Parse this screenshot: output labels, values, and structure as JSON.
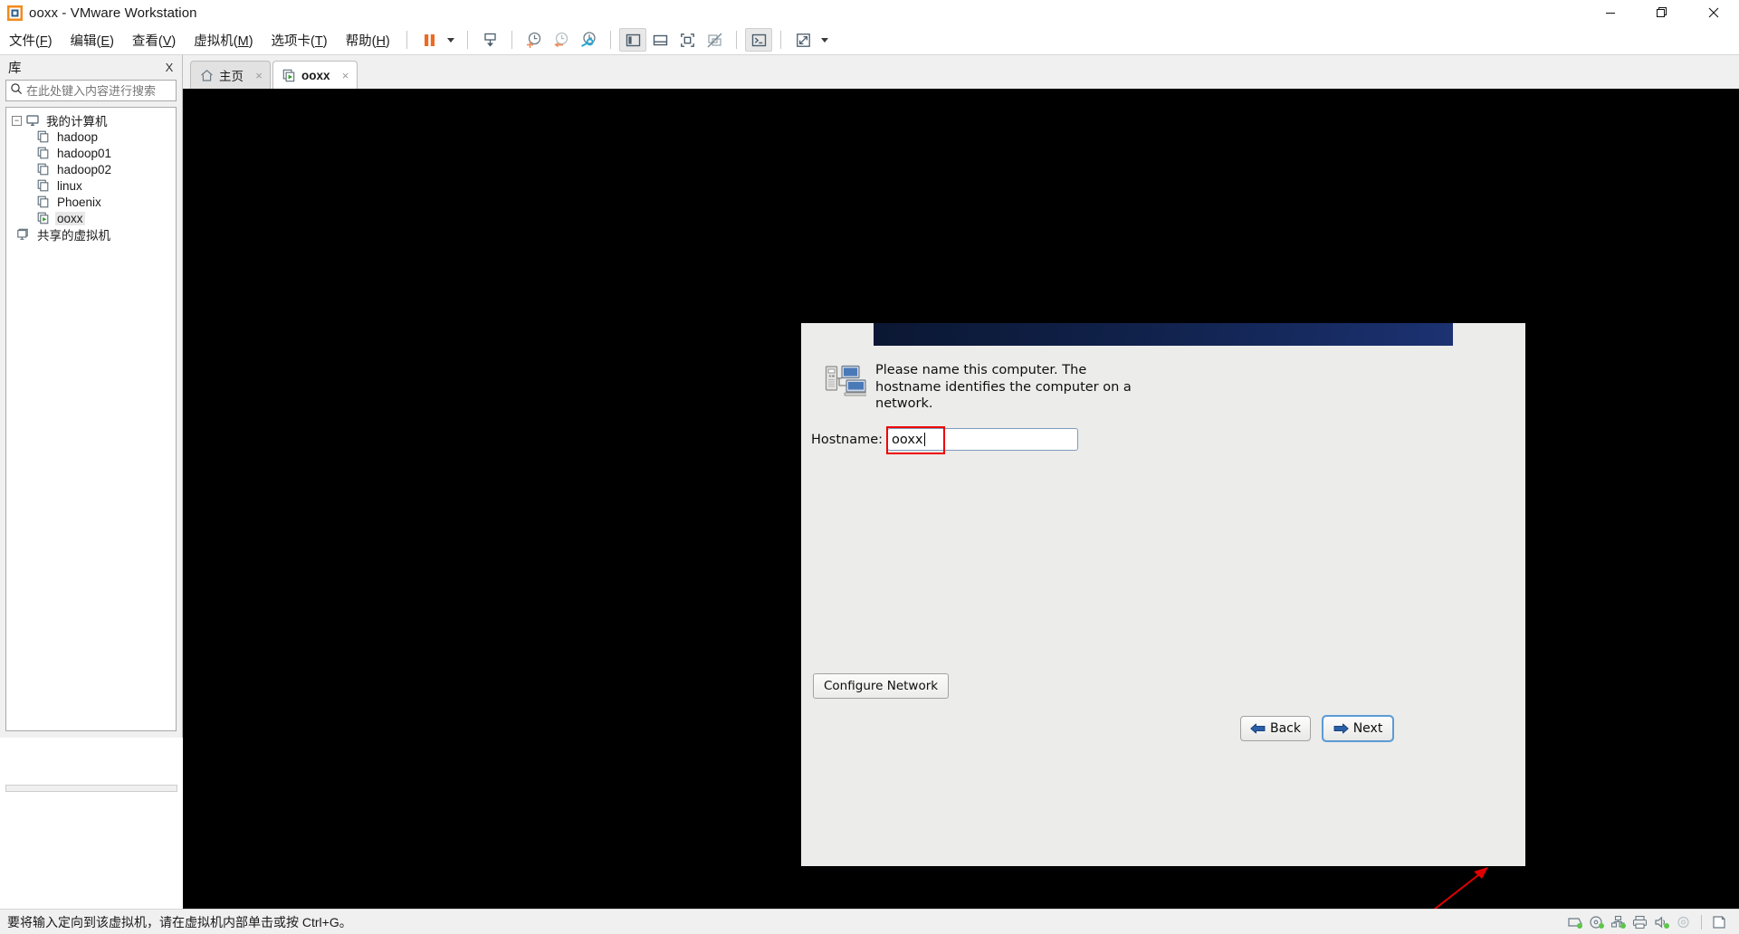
{
  "window": {
    "title": "ooxx - VMware Workstation",
    "app_icon": "vmware-logo-icon",
    "controls": {
      "minimize": "—",
      "restore": "❐",
      "close": "✕"
    }
  },
  "menubar": {
    "items": [
      {
        "name": "file",
        "text": "文件(F)",
        "label": "文件(",
        "accel": "F",
        "tail": ")"
      },
      {
        "name": "edit",
        "text": "编辑(E)",
        "label": "编辑(",
        "accel": "E",
        "tail": ")"
      },
      {
        "name": "view",
        "text": "查看(V)",
        "label": "查看(",
        "accel": "V",
        "tail": ")"
      },
      {
        "name": "vm",
        "text": "虚拟机(M)",
        "label": "虚拟机(",
        "accel": "M",
        "tail": ")"
      },
      {
        "name": "tabs",
        "text": "选项卡(T)",
        "label": "选项卡(",
        "accel": "T",
        "tail": ")"
      },
      {
        "name": "help",
        "text": "帮助(H)",
        "label": "帮助(",
        "accel": "H",
        "tail": ")"
      }
    ]
  },
  "toolbar": {
    "buttons": [
      {
        "name": "suspend-button",
        "icon": "pause-icon",
        "title": "挂起"
      },
      {
        "name": "power-dropdown",
        "icon": "chevron-down-icon",
        "title": "电源"
      },
      {
        "name": "send-ctrl-alt-del-button",
        "icon": "send-key-icon",
        "title": "发送组合键"
      },
      {
        "name": "take-snapshot-button",
        "icon": "snapshot-add-icon",
        "title": "拍摄快照"
      },
      {
        "name": "revert-snapshot-button",
        "icon": "snapshot-revert-icon",
        "title": "恢复快照"
      },
      {
        "name": "snapshot-manager-button",
        "icon": "snapshot-manager-icon",
        "title": "快照管理器"
      },
      {
        "name": "show-library-button",
        "icon": "panel-left-icon",
        "title": "显示库"
      },
      {
        "name": "show-thumbnail-bar-button",
        "icon": "panel-bottom-icon",
        "title": "显示缩略图栏"
      },
      {
        "name": "enter-fullscreen-button",
        "icon": "fullscreen-icon",
        "title": "全屏"
      },
      {
        "name": "unity-mode-button",
        "icon": "unity-icon",
        "title": "Unity 模式"
      },
      {
        "name": "console-button",
        "icon": "terminal-icon",
        "title": "控制台"
      },
      {
        "name": "stretch-guest-button",
        "icon": "resize-icon",
        "title": "自动调整大小"
      },
      {
        "name": "stretch-dropdown",
        "icon": "chevron-down-icon",
        "title": "更多"
      }
    ]
  },
  "sidebar": {
    "title": "库",
    "close_label": "X",
    "search": {
      "placeholder": "在此处键入内容进行搜索",
      "value": "",
      "icon": "search-icon",
      "dropdown_icon": "chevron-down-icon"
    },
    "tree": {
      "root": {
        "label": "我的计算机",
        "icon": "computer-icon",
        "expanded": true,
        "twisty": "−"
      },
      "children": [
        {
          "label": "hadoop",
          "icon": "vm-icon",
          "running": false,
          "selected": false
        },
        {
          "label": "hadoop01",
          "icon": "vm-icon",
          "running": false,
          "selected": false
        },
        {
          "label": "hadoop02",
          "icon": "vm-icon",
          "running": false,
          "selected": false
        },
        {
          "label": "linux",
          "icon": "vm-icon",
          "running": false,
          "selected": false
        },
        {
          "label": "Phoenix",
          "icon": "vm-icon",
          "running": false,
          "selected": false
        },
        {
          "label": "ooxx",
          "icon": "vm-running-icon",
          "running": true,
          "selected": true
        }
      ],
      "shared": {
        "label": "共享的虚拟机",
        "icon": "shared-vm-icon"
      }
    }
  },
  "tabs": [
    {
      "name": "tab-home",
      "label": "主页",
      "icon": "home-icon",
      "active": false,
      "close_icon": "×"
    },
    {
      "name": "tab-ooxx",
      "label": "ooxx",
      "icon": "vm-running-icon",
      "active": true,
      "close_icon": "×"
    }
  ],
  "installer": {
    "icon": "computer-network-icon",
    "description": "Please name this computer.  The hostname identifies the computer on a network.",
    "hostname_label": "Hostname:",
    "hostname_value": "ooxx",
    "configure_network_label": "Configure Network",
    "back_label": "Back",
    "next_label": "Next",
    "banner_color": "#12265a",
    "highlight_color": "#ee0000",
    "annotation": {
      "type": "arrow",
      "color": "#e00000",
      "points_to": "next-button"
    }
  },
  "statusbar": {
    "message": "要将输入定向到该虚拟机，请在虚拟机内部单击或按 Ctrl+G。",
    "devices": [
      {
        "name": "hard-disk-icon",
        "connected": true
      },
      {
        "name": "cd-dvd-icon",
        "connected": true
      },
      {
        "name": "network-adapter-icon",
        "connected": true
      },
      {
        "name": "printer-icon",
        "connected": false
      },
      {
        "name": "sound-card-icon",
        "connected": true
      },
      {
        "name": "usb-icon",
        "connected": false
      },
      {
        "name": "floppy-icon",
        "connected": false
      }
    ]
  }
}
